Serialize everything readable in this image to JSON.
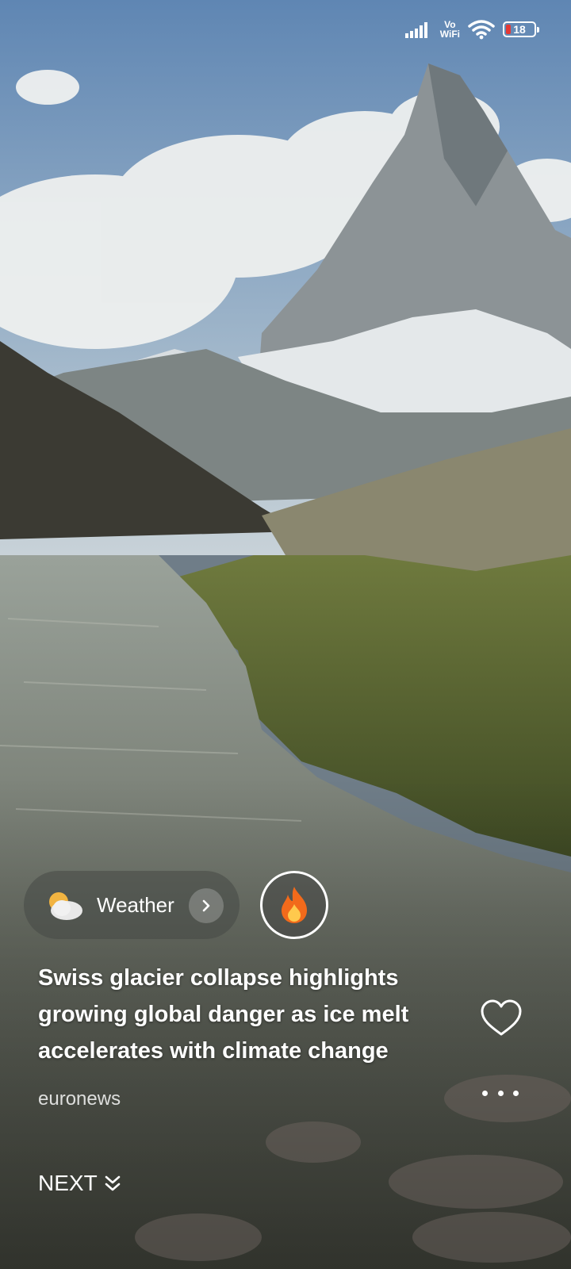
{
  "status_bar": {
    "network": "Vo WiFi",
    "battery": "18",
    "battery_color": "#e53935"
  },
  "weather_chip": {
    "label": "Weather",
    "icon": "partly-cloudy-icon"
  },
  "trending_chip": {
    "icon": "fire-icon"
  },
  "news": {
    "headline": "Swiss glacier collapse highlights growing global danger as ice melt accelerates with climate change",
    "source": "euronews"
  },
  "footer": {
    "next_label": "NEXT"
  }
}
